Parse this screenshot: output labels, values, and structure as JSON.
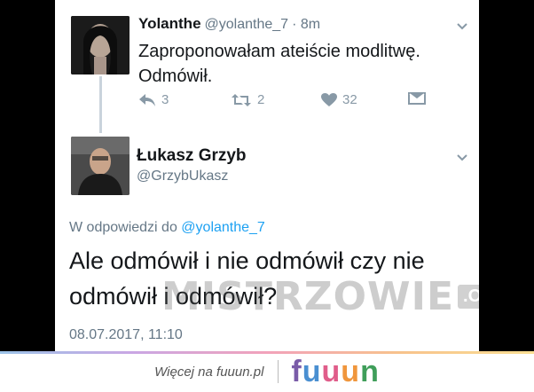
{
  "tweet1": {
    "author_name": "Yolanthe",
    "author_handle": "@yolanthe_7",
    "time": "· 8m",
    "text": "Zaproponowałam ateiście modlitwę. Odmówił.",
    "actions": {
      "reply_count": "3",
      "retweet_count": "2",
      "like_count": "32"
    }
  },
  "tweet2": {
    "author_name": "Łukasz Grzyb",
    "author_handle": "@GrzybUkasz",
    "reply_prefix": "W odpowiedzi do ",
    "reply_mention": "@yolanthe_7",
    "text": "Ale odmówił i nie odmówił czy nie odmówił i odmówił?",
    "timestamp": "08.07.2017, 11:10"
  },
  "watermark": {
    "main": "MISTRZOWIE",
    "suffix": ".ORG"
  },
  "footer": {
    "more_text": "Więcej na fuuun.pl",
    "logo_letters": [
      {
        "char": "f",
        "color": "#7a5ca8"
      },
      {
        "char": "u",
        "color": "#4a8fd1"
      },
      {
        "char": "u",
        "color": "#e05d8a"
      },
      {
        "char": "u",
        "color": "#f0963c"
      },
      {
        "char": "n",
        "color": "#3f9e5a"
      }
    ]
  }
}
